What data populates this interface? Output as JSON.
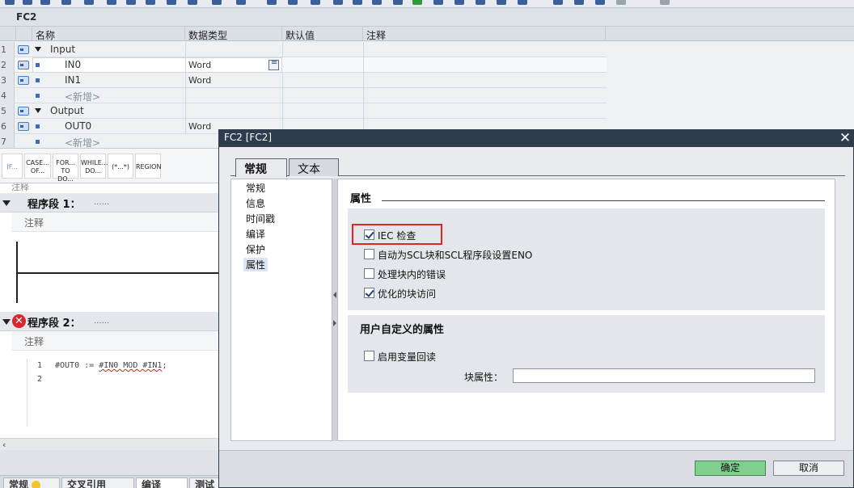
{
  "block": {
    "title": "FC2"
  },
  "table": {
    "headers": [
      "名称",
      "数据类型",
      "默认值",
      "注释"
    ],
    "rows": [
      {
        "num": "1",
        "name": "Input",
        "type": ""
      },
      {
        "num": "2",
        "name": "IN0",
        "type": "Word"
      },
      {
        "num": "3",
        "name": "IN1",
        "type": "Word"
      },
      {
        "num": "4",
        "name": "<新增>",
        "type": ""
      },
      {
        "num": "5",
        "name": "Output",
        "type": ""
      },
      {
        "num": "6",
        "name": "OUT0",
        "type": "Word"
      },
      {
        "num": "7",
        "name": "<新增>",
        "type": ""
      }
    ]
  },
  "scl_bar": {
    "items": [
      "IF...",
      "CASE... OF...",
      "FOR... TO DO...",
      "WHILE... DO...",
      "(*...*)",
      "REGION"
    ]
  },
  "editor": {
    "top_comment": "注释",
    "seg1": {
      "title": "程序段 1：",
      "dots": "......",
      "comment": "注释"
    },
    "seg2": {
      "title": "程序段 2：",
      "dots": "......",
      "comment": "注释"
    },
    "code": {
      "lines": [
        "1",
        "2"
      ],
      "line1_prefix": "#OUT0 := ",
      "line1_error": "#IN0 MOD #IN1",
      "line1_suffix": ";"
    }
  },
  "bottom_tabs": [
    "常规",
    "交叉引用",
    "编译",
    "测试"
  ],
  "dialog": {
    "title": "FC2 [FC2]",
    "close": "✕",
    "tabs": [
      "常规",
      "文本"
    ],
    "nav": [
      "常规",
      "信息",
      "时间戳",
      "编译",
      "保护",
      "属性"
    ],
    "section_title": "属性",
    "checkboxes": [
      {
        "label": "IEC 检查",
        "checked": true
      },
      {
        "label": "自动为SCL块和SCL程序段设置ENO",
        "checked": false
      },
      {
        "label": "处理块内的错误",
        "checked": false
      },
      {
        "label": "优化的块访问",
        "checked": true
      }
    ],
    "user_section_title": "用户自定义的属性",
    "readback_label": "启用变量回读",
    "block_attr_label": "块属性：",
    "block_attr_value": "",
    "ok": "确定",
    "cancel": "取消"
  },
  "colors": {
    "accent_ok": "#7fcf8f",
    "error": "#d8272e",
    "highlight": "#e0242a",
    "titlebar": "#2f3c4e"
  }
}
